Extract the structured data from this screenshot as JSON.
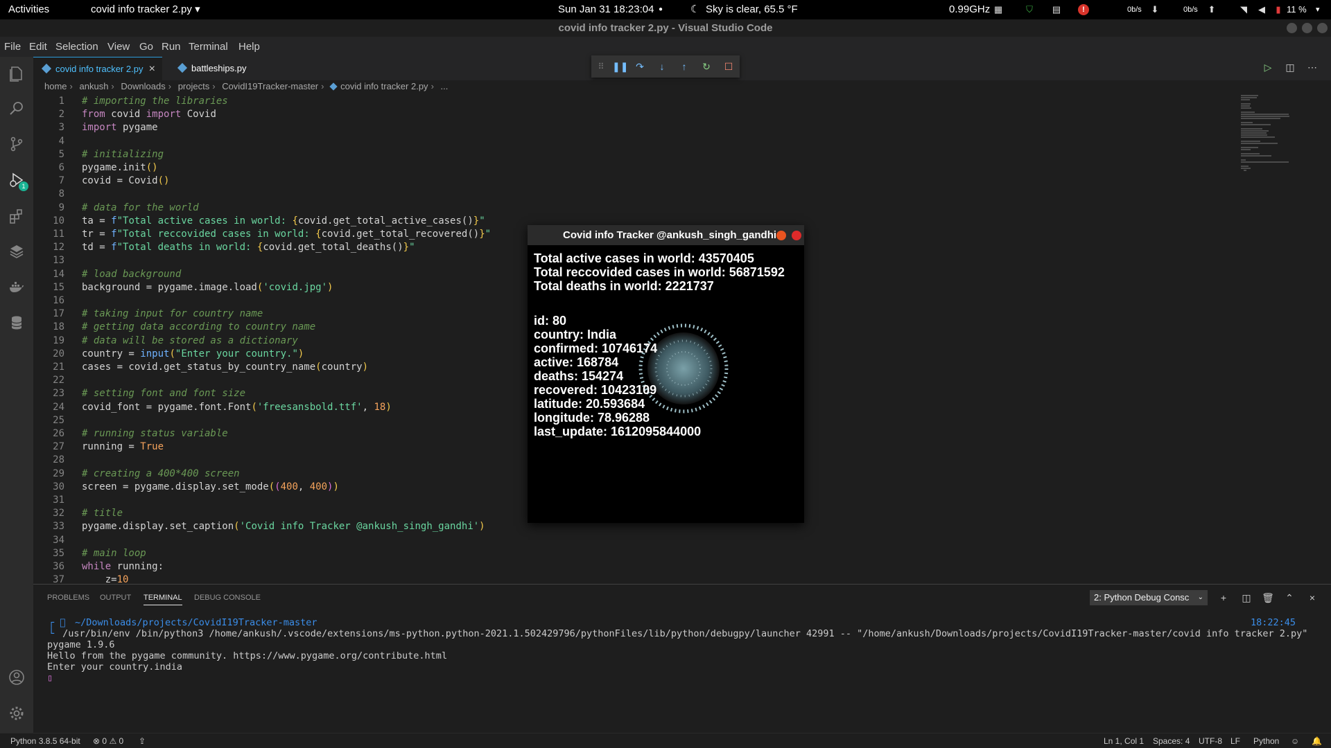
{
  "topbar": {
    "activities": "Activities",
    "app_menu": "covid info tracker 2.py ▾",
    "datetime": "Sun Jan 31  18:23:04",
    "weather": "Sky is clear, 65.5 °F",
    "cpu": "0.99GHz",
    "net_down": "0b/s",
    "net_up": "0b/s",
    "battery": "11 %"
  },
  "window": {
    "title": "covid info tracker 2.py - Visual Studio Code"
  },
  "menu": [
    "File",
    "Edit",
    "Selection",
    "View",
    "Go",
    "Run",
    "Terminal",
    "Help"
  ],
  "tabs": [
    {
      "label": "covid info tracker 2.py",
      "active": true
    },
    {
      "label": "battleships.py",
      "active": false
    }
  ],
  "breadcrumb": [
    "home",
    "ankush",
    "Downloads",
    "projects",
    "CovidI19Tracker-master",
    "covid info tracker 2.py",
    "..."
  ],
  "debug_badge": "1",
  "code": [
    {
      "n": "1",
      "t": "# importing the libraries"
    },
    {
      "n": "2",
      "t": "from covid import Covid"
    },
    {
      "n": "3",
      "t": "import pygame"
    },
    {
      "n": "4",
      "t": ""
    },
    {
      "n": "5",
      "t": "# initializing"
    },
    {
      "n": "6",
      "t": "pygame.init()"
    },
    {
      "n": "7",
      "t": "covid = Covid()"
    },
    {
      "n": "8",
      "t": ""
    },
    {
      "n": "9",
      "t": "# data for the world"
    },
    {
      "n": "10",
      "t": "ta = f\"Total active cases in world: {covid.get_total_active_cases()}\""
    },
    {
      "n": "11",
      "t": "tr = f\"Total reccovided cases in world: {covid.get_total_recovered()}\""
    },
    {
      "n": "12",
      "t": "td = f\"Total deaths in world: {covid.get_total_deaths()}\""
    },
    {
      "n": "13",
      "t": ""
    },
    {
      "n": "14",
      "t": "# load background"
    },
    {
      "n": "15",
      "t": "background = pygame.image.load('covid.jpg')"
    },
    {
      "n": "16",
      "t": ""
    },
    {
      "n": "17",
      "t": "# taking input for country name"
    },
    {
      "n": "18",
      "t": "# getting data according to country name"
    },
    {
      "n": "19",
      "t": "# data will be stored as a dictionary"
    },
    {
      "n": "20",
      "t": "country = input(\"Enter your country.\")"
    },
    {
      "n": "21",
      "t": "cases = covid.get_status_by_country_name(country)"
    },
    {
      "n": "22",
      "t": ""
    },
    {
      "n": "23",
      "t": "# setting font and font size"
    },
    {
      "n": "24",
      "t": "covid_font = pygame.font.Font('freesansbold.ttf', 18)"
    },
    {
      "n": "25",
      "t": ""
    },
    {
      "n": "26",
      "t": "# running status variable"
    },
    {
      "n": "27",
      "t": "running = True"
    },
    {
      "n": "28",
      "t": ""
    },
    {
      "n": "29",
      "t": "# creating a 400*400 screen"
    },
    {
      "n": "30",
      "t": "screen = pygame.display.set_mode((400, 400))"
    },
    {
      "n": "31",
      "t": ""
    },
    {
      "n": "32",
      "t": "# title"
    },
    {
      "n": "33",
      "t": "pygame.display.set_caption('Covid info Tracker @ankush_singh_gandhi')"
    },
    {
      "n": "34",
      "t": ""
    },
    {
      "n": "35",
      "t": "# main loop"
    },
    {
      "n": "36",
      "t": "while running:"
    },
    {
      "n": "37",
      "t": "    z=10"
    }
  ],
  "pygame": {
    "title": "Covid info Tracker @ankush_singh_gandhi",
    "world": [
      "Total active cases in world: 43570405",
      "Total reccovided cases in world: 56871592",
      "Total deaths in world: 2221737"
    ],
    "country": [
      "id: 80",
      "country: India",
      "confirmed: 10746174",
      "active: 168784",
      "deaths: 154274",
      "recovered: 10423109",
      "latitude: 20.593684",
      "longitude: 78.96288",
      "last_update: 1612095844000"
    ]
  },
  "panel": {
    "tabs": [
      "PROBLEMS",
      "OUTPUT",
      "TERMINAL",
      "DEBUG CONSOLE"
    ],
    "active_tab": "TERMINAL",
    "terminal_select": "2: Python Debug Consc",
    "prompt_path": "~/Downloads/projects/CovidI19Tracker-master",
    "prompt_time": "18:22:45",
    "lines": [
      " /usr/bin/env /bin/python3 /home/ankush/.vscode/extensions/ms-python.python-2021.1.502429796/pythonFiles/lib/python/debugpy/launcher 42991 -- \"/home/ankush/Downloads/projects/CovidI19Tracker-master/covid info tracker 2.py\"",
      "pygame 1.9.6",
      "Hello from the pygame community. https://www.pygame.org/contribute.html",
      "Enter your country.india"
    ]
  },
  "status": {
    "interpreter": "Python 3.8.5 64-bit",
    "errors": "0",
    "warnings": "0",
    "position": "Ln 1, Col 1",
    "spaces": "Spaces: 4",
    "encoding": "UTF-8",
    "eol": "LF",
    "language": "Python"
  },
  "colors": {
    "accent": "#2d9cdb",
    "debug_badge": "#1ab394"
  }
}
